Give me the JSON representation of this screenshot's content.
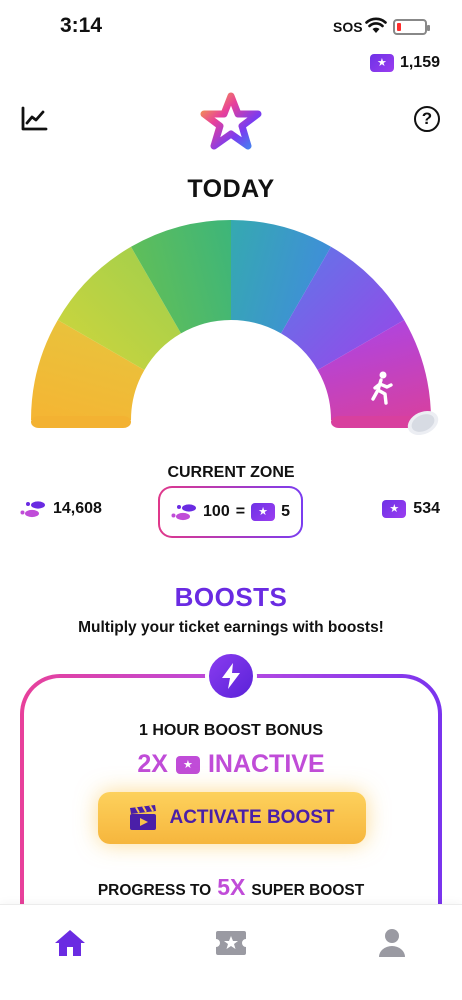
{
  "status_bar": {
    "time": "3:14",
    "carrier": "SOS"
  },
  "balance": {
    "tickets": "1,159",
    "icon": "ticket-star-icon"
  },
  "header": {
    "title": "TODAY",
    "left_icon": "chart-icon",
    "right_icon": "help-icon",
    "logo": "star-logo"
  },
  "zone": {
    "title": "CURRENT ZONE",
    "steps": "14,608",
    "rate_steps": "100",
    "rate_equals": "=",
    "rate_tickets": "5",
    "tickets_earned": "534",
    "gauge_level": 1.0
  },
  "boosts": {
    "title": "BOOSTS",
    "subtitle": "Multiply your ticket earnings with boosts!",
    "card_label": "1 HOUR BOOST BONUS",
    "multiplier": "2X",
    "status": "INACTIVE",
    "button_label": "ACTIVATE BOOST",
    "progress_prefix": "PROGRESS TO",
    "progress_multiplier": "5X",
    "progress_suffix": "SUPER BOOST"
  },
  "tabs": [
    {
      "name": "home",
      "icon": "home-icon",
      "active": true
    },
    {
      "name": "tickets",
      "icon": "ticket-icon",
      "active": false
    },
    {
      "name": "profile",
      "icon": "person-icon",
      "active": false
    }
  ],
  "colors": {
    "accent": "#6a2be2",
    "pink": "#c04cd8",
    "button": "#f9c44c"
  }
}
